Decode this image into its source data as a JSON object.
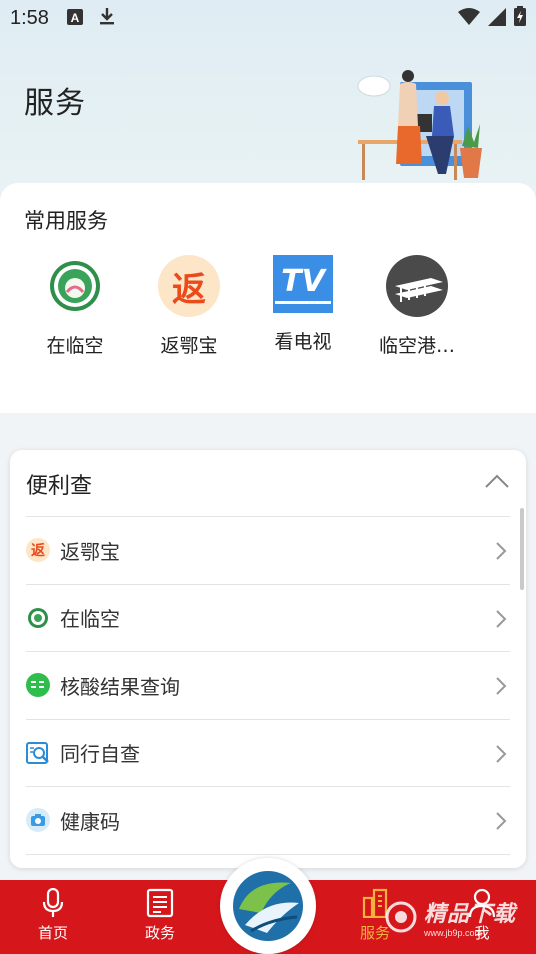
{
  "status_bar": {
    "time": "1:58"
  },
  "page": {
    "title": "服务"
  },
  "common_services": {
    "title": "常用服务",
    "items": [
      {
        "label": "在临空",
        "icon": "zai-linkong-logo-icon"
      },
      {
        "label": "返鄂宝",
        "icon": "fan-badge-icon",
        "glyph": "返"
      },
      {
        "label": "看电视",
        "icon": "tv-icon",
        "glyph": "TV"
      },
      {
        "label": "临空港…",
        "icon": "linkong-port-icon"
      }
    ]
  },
  "convenience": {
    "title": "便利查",
    "items": [
      {
        "label": "返鄂宝",
        "icon": "fan-small-icon",
        "glyph": "返"
      },
      {
        "label": "在临空",
        "icon": "zai-linkong-small-icon"
      },
      {
        "label": "核酸结果查询",
        "icon": "health-green-icon"
      },
      {
        "label": "同行自查",
        "icon": "search-doc-icon"
      },
      {
        "label": "健康码",
        "icon": "camera-icon"
      }
    ]
  },
  "bottom_nav": {
    "items": [
      {
        "label": "首页",
        "icon": "microphone-icon"
      },
      {
        "label": "政务",
        "icon": "newspaper-icon"
      },
      {
        "label": "服务",
        "icon": "buildings-icon",
        "active": true
      },
      {
        "label": "我",
        "icon": "person-icon"
      }
    ]
  },
  "watermark": {
    "text": "精品下载",
    "sub": "www.jb9p.com"
  },
  "colors": {
    "nav_red": "#d5171c",
    "active_orange": "#f4b23c",
    "tv_blue": "#3a8ee6"
  }
}
